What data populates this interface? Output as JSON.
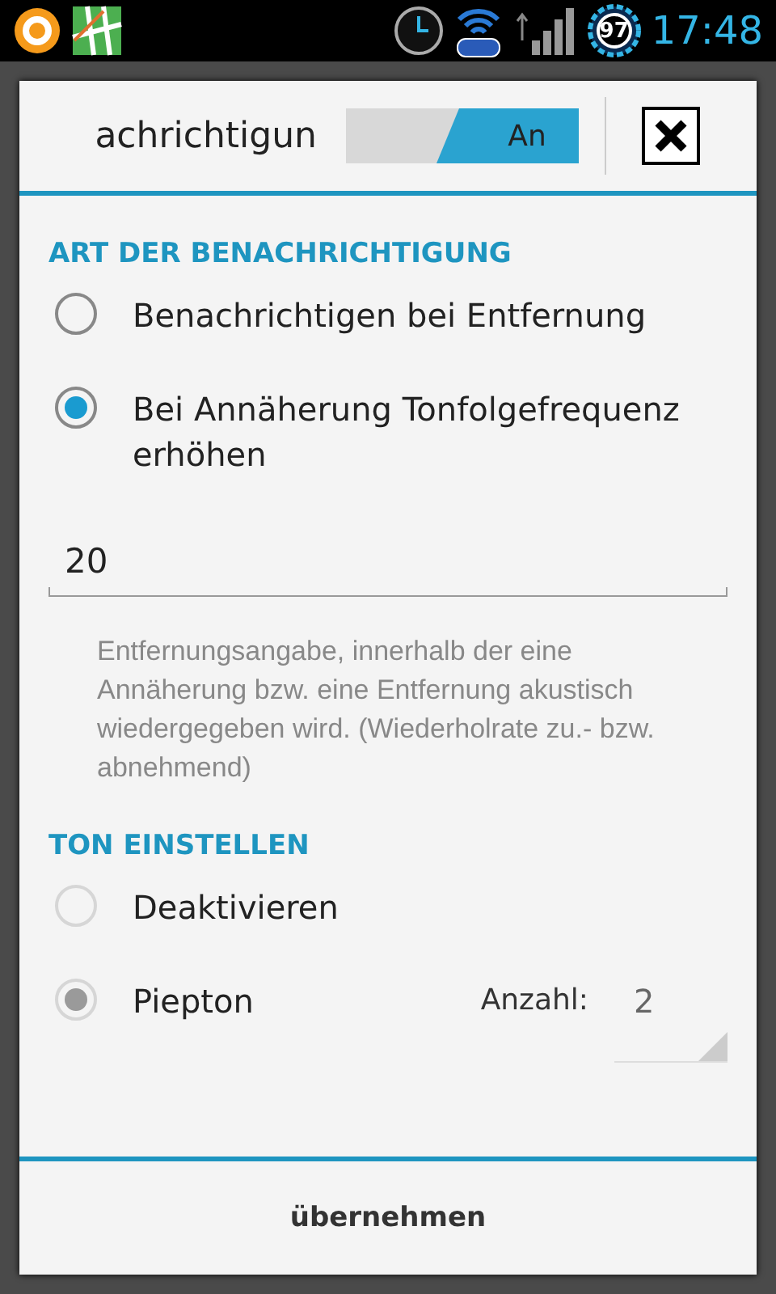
{
  "status_bar": {
    "battery_level": "97",
    "time": "17:48"
  },
  "dialog": {
    "title": "achrichtigun",
    "switch": {
      "label": "An",
      "on": true
    },
    "sections": [
      {
        "heading": "ART DER BENACHRICHTIGUNG",
        "items": [
          {
            "kind": "radio",
            "label": "Benachrichtigen bei Entfernung",
            "selected": false,
            "disabled": false
          },
          {
            "kind": "radio",
            "label": "Bei Annäherung Tonfolgefrequenz erhöhen",
            "selected": true,
            "disabled": false
          },
          {
            "kind": "field",
            "value": "20"
          },
          {
            "kind": "hint",
            "text": "Entfernungsangabe, innerhalb der eine Annäherung bzw. eine Entfernung akustisch wiedergegeben wird. (Wiederholrate zu.- bzw. abnehmend)"
          }
        ]
      },
      {
        "heading": "TON EINSTELLEN",
        "items": [
          {
            "kind": "radio",
            "label": "Deaktivieren",
            "selected": false,
            "disabled": true
          },
          {
            "kind": "radio",
            "label": "Piepton",
            "selected": true,
            "disabled": true,
            "count_label": "Anzahl:",
            "count_value": "2"
          }
        ]
      }
    ],
    "button": "übernehmen"
  }
}
